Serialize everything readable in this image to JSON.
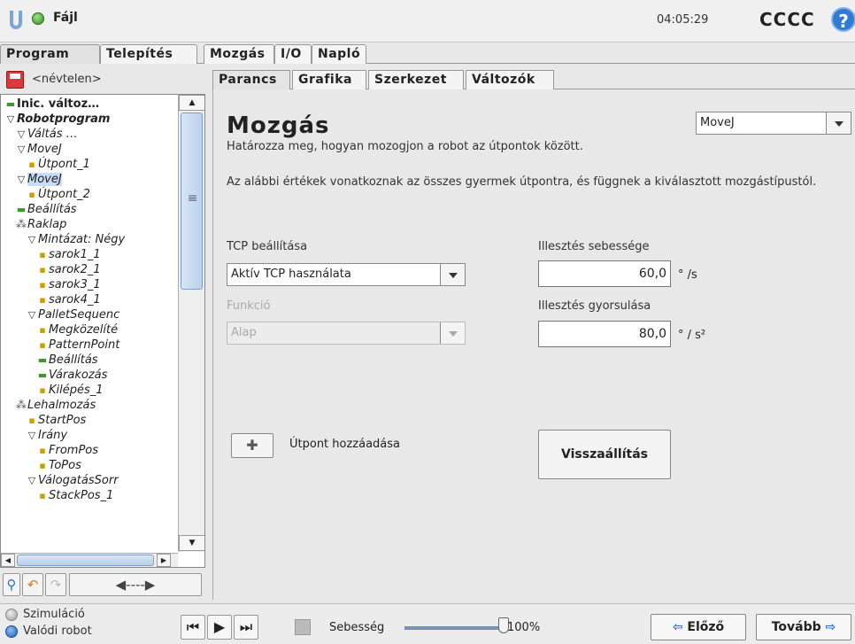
{
  "header": {
    "file_label": "Fájl",
    "time": "04:05:29",
    "robot_name": "CCCC",
    "help_label": "?"
  },
  "main_tabs": [
    "Program",
    "Telepítés",
    "Mozgás",
    "I/O",
    "Napló"
  ],
  "program": {
    "name": "<névtelen>"
  },
  "tree": [
    {
      "label": "Inic. változ…",
      "glyph": "bar",
      "indent": 0,
      "style": "plain"
    },
    {
      "label": "Robotprogram",
      "glyph": "tri",
      "indent": 0,
      "style": "bold"
    },
    {
      "label": "Váltás …",
      "glyph": "tri",
      "indent": 1
    },
    {
      "label": "MoveJ",
      "glyph": "tri",
      "indent": 1
    },
    {
      "label": "Útpont_1",
      "glyph": "dot",
      "indent": 2
    },
    {
      "label": "MoveJ",
      "glyph": "tri",
      "indent": 1,
      "selected": true
    },
    {
      "label": "Útpont_2",
      "glyph": "dot",
      "indent": 2
    },
    {
      "label": "Beállítás",
      "glyph": "bar",
      "indent": 1
    },
    {
      "label": "Raklap",
      "glyph": "grp",
      "indent": 1
    },
    {
      "label": "Mintázat: Négy",
      "glyph": "tri",
      "indent": 2
    },
    {
      "label": "sarok1_1",
      "glyph": "dot",
      "indent": 3
    },
    {
      "label": "sarok2_1",
      "glyph": "dot",
      "indent": 3
    },
    {
      "label": "sarok3_1",
      "glyph": "dot",
      "indent": 3
    },
    {
      "label": "sarok4_1",
      "glyph": "dot",
      "indent": 3
    },
    {
      "label": "PalletSequenc",
      "glyph": "tri",
      "indent": 2
    },
    {
      "label": "Megközelíté",
      "glyph": "dot",
      "indent": 3
    },
    {
      "label": "PatternPoint",
      "glyph": "dot",
      "indent": 3
    },
    {
      "label": "Beállítás",
      "glyph": "bar",
      "indent": 3
    },
    {
      "label": "Várakozás",
      "glyph": "bar",
      "indent": 3
    },
    {
      "label": "Kilépés_1",
      "glyph": "dot",
      "indent": 3
    },
    {
      "label": "Lehalmozás",
      "glyph": "grp",
      "indent": 1
    },
    {
      "label": "StartPos",
      "glyph": "dot",
      "indent": 2
    },
    {
      "label": "Irány",
      "glyph": "tri",
      "indent": 2
    },
    {
      "label": "FromPos",
      "glyph": "dot",
      "indent": 3
    },
    {
      "label": "ToPos",
      "glyph": "dot",
      "indent": 3
    },
    {
      "label": "VálogatásSorr",
      "glyph": "tri",
      "indent": 2
    },
    {
      "label": "StackPos_1",
      "glyph": "dot",
      "indent": 3
    }
  ],
  "sub_tabs": [
    "Parancs",
    "Grafika",
    "Szerkezet",
    "Változók"
  ],
  "command": {
    "title": "Mozgás",
    "move_type": "MoveJ",
    "description": "Határozza meg, hogyan mozogjon a robot az útpontok között.",
    "note": "Az alábbi értékek vonatkoznak az összes gyermek útpontra, és függnek a kiválasztott mozgástípustól.",
    "tcp_label": "TCP beállítása",
    "tcp_value": "Aktív TCP használata",
    "feature_label": "Funkció",
    "feature_value": "Alap",
    "speed_label": "Illesztés sebessége",
    "speed_value": "60,0",
    "speed_unit": "° /s",
    "accel_label": "Illesztés gyorsulása",
    "accel_value": "80,0",
    "accel_unit": "° / s²",
    "add_waypoint_label": "Útpont hozzáadása",
    "reset_label": "Visszaállítás"
  },
  "footer": {
    "sim_label": "Szimuláció",
    "real_label": "Valódi robot",
    "speed_label": "Sebesség",
    "speed_percent": "100%",
    "speed_fraction": 1.0,
    "prev_label": "Előző",
    "next_label": "Tovább"
  },
  "colors": {
    "accent": "#2e7bd6",
    "selected": "#c7dcf5",
    "run_green": "#2f8a1d"
  }
}
